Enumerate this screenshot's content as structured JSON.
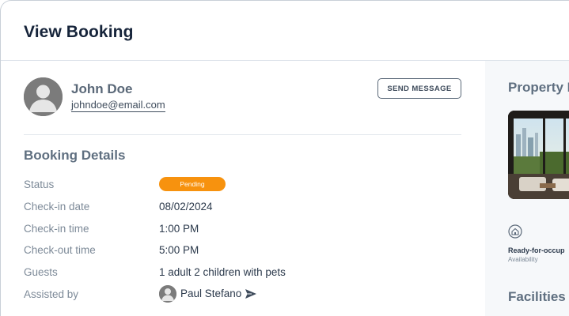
{
  "page": {
    "title": "View Booking"
  },
  "guest": {
    "name": "John Doe",
    "email": "johndoe@email.com",
    "send_message_label": "SEND MESSAGE"
  },
  "booking": {
    "section_title": "Booking Details",
    "rows": [
      {
        "label": "Status",
        "value": "Pending"
      },
      {
        "label": "Check-in date",
        "value": "08/02/2024"
      },
      {
        "label": "Check-in time",
        "value": "1:00 PM"
      },
      {
        "label": "Check-out time",
        "value": "5:00 PM"
      },
      {
        "label": "Guests",
        "value": "1 adult 2 children with pets"
      },
      {
        "label": "Assisted by",
        "value": "Paul Stefano"
      }
    ],
    "status_color": "#f7920e"
  },
  "property": {
    "section_title": "Property D",
    "availability_value": "Ready-for-occup",
    "availability_label": "Availability",
    "facilities_title": "Facilities a"
  },
  "icons": {
    "avatar": "user-avatar-icon",
    "send": "paper-plane-icon",
    "availability": "home-icon"
  }
}
